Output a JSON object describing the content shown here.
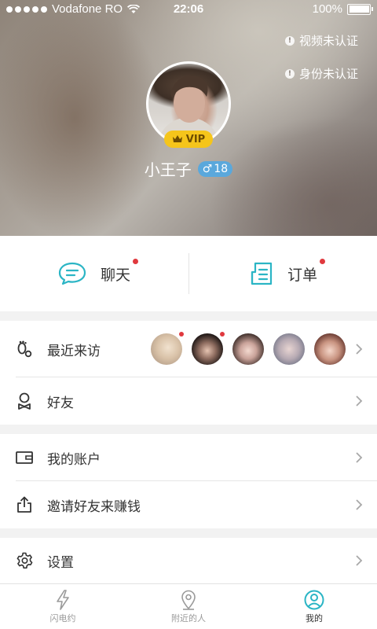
{
  "status_bar": {
    "carrier": "Vodafone RO",
    "time": "22:06",
    "battery": "100%"
  },
  "profile": {
    "verify_video": "视频未认证",
    "verify_identity": "身份未认证",
    "vip_label": "VIP",
    "nickname": "小王子",
    "gender_symbol": "♂",
    "age": "18"
  },
  "actions": {
    "chat_label": "聊天",
    "orders_label": "订单"
  },
  "menu": {
    "recent_visitors": "最近来访",
    "friends": "好友",
    "my_account": "我的账户",
    "invite": "邀请好友来赚钱",
    "settings": "设置"
  },
  "tabs": [
    {
      "label": "闪电约",
      "icon": "lightning-icon"
    },
    {
      "label": "附近的人",
      "icon": "location-pin-icon"
    },
    {
      "label": "我的",
      "icon": "profile-icon"
    }
  ],
  "colors": {
    "accent_teal": "#2bb5c5",
    "badge_red": "#e0393e",
    "vip_yellow": "#f5c51b",
    "gender_blue": "#5aa8dc"
  }
}
